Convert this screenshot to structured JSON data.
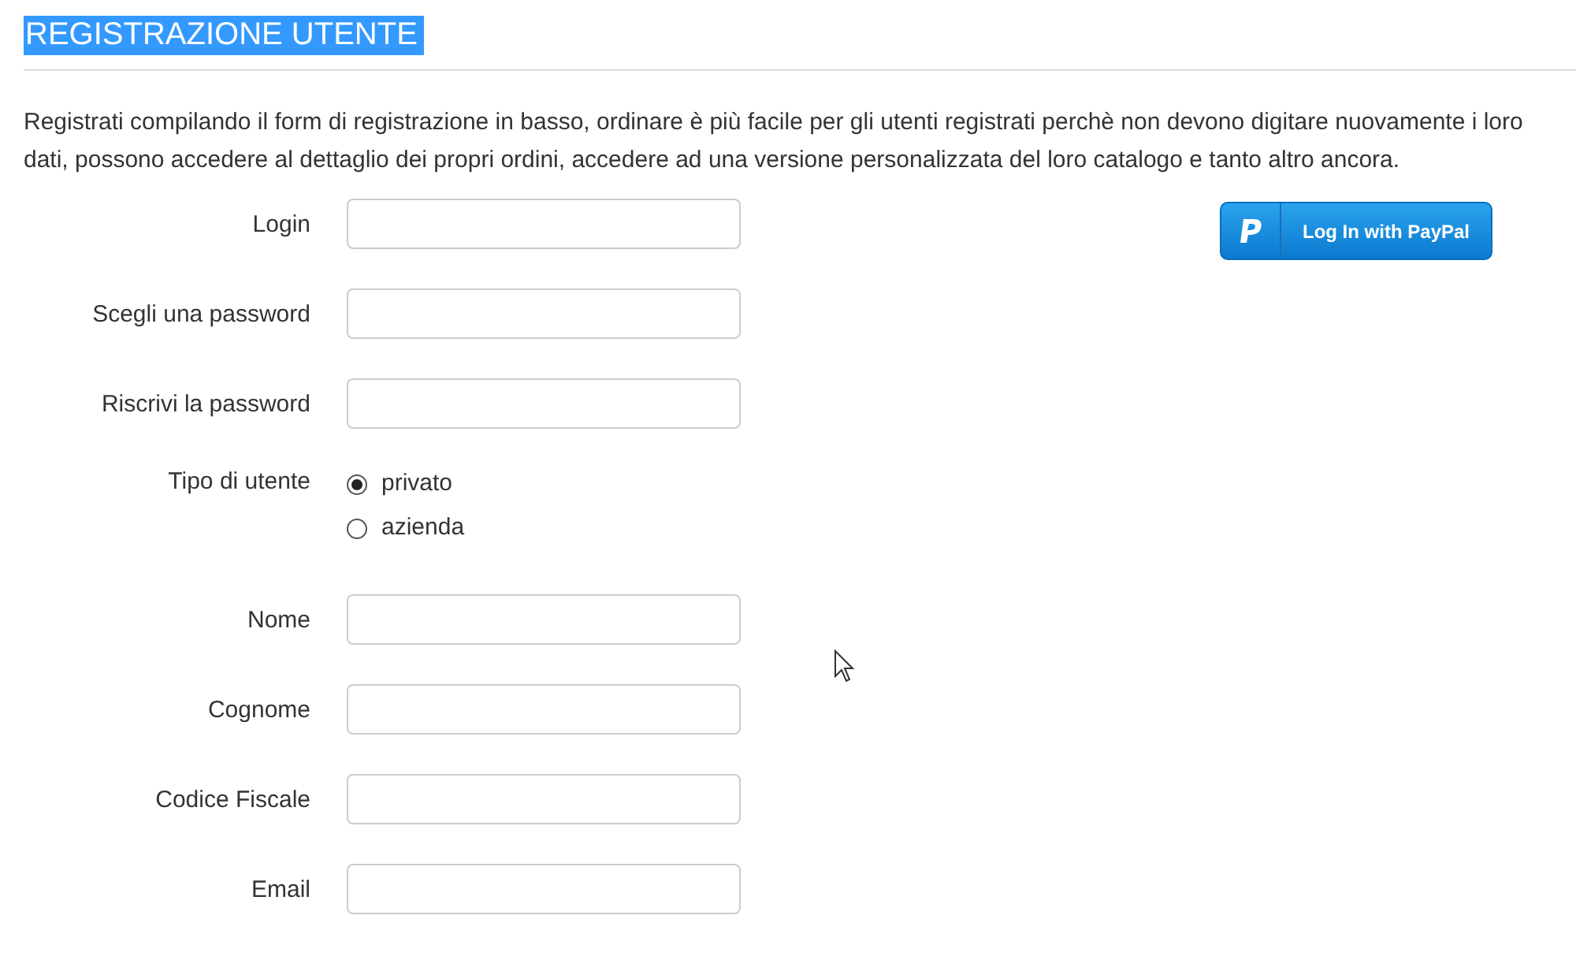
{
  "title": "REGISTRAZIONE UTENTE",
  "intro": "Registrati compilando il form di registrazione in basso, ordinare è più facile per gli utenti registrati perchè non devono digitare nuovamente i loro dati, possono accedere al dettaglio dei propri ordini, accedere ad una versione personalizzata del loro catalogo e tanto altro ancora.",
  "paypal_button": {
    "label": "Log In with PayPal"
  },
  "fields": [
    {
      "kind": "text",
      "label": "Login"
    },
    {
      "kind": "password",
      "label": "Scegli una password"
    },
    {
      "kind": "password",
      "label": "Riscrivi la password"
    },
    {
      "kind": "radio",
      "label": "Tipo di utente",
      "options": [
        {
          "label": "privato",
          "selected": true
        },
        {
          "label": "azienda",
          "selected": false
        }
      ]
    },
    {
      "kind": "text",
      "label": "Nome"
    },
    {
      "kind": "text",
      "label": "Cognome"
    },
    {
      "kind": "text",
      "label": "Codice Fiscale"
    },
    {
      "kind": "text",
      "label": "Email"
    }
  ]
}
